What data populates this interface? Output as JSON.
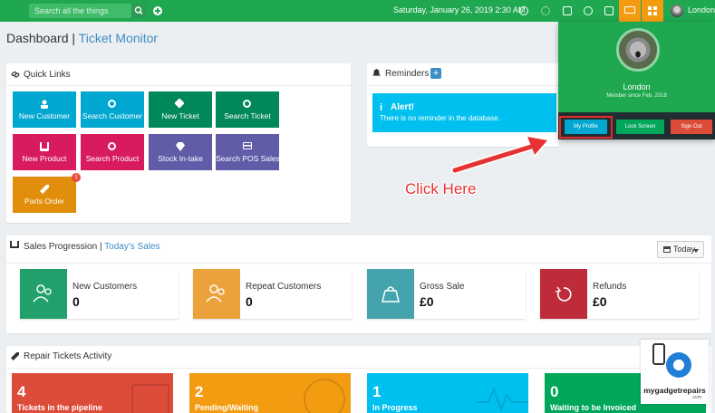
{
  "topbar": {
    "search_placeholder": "Search all the things",
    "datetime": "Saturday, January 26, 2019 2:30 AM",
    "user_name": "London"
  },
  "page": {
    "title": "Dashboard",
    "separator": "|",
    "subtitle": "Ticket Monitor"
  },
  "quick_links": {
    "title": "Quick Links",
    "items": [
      {
        "label": "New Customer",
        "color": "#00a7d0",
        "icon": "user-icon"
      },
      {
        "label": "Search Customer",
        "color": "#00a7d0",
        "icon": "search-icon"
      },
      {
        "label": "New Ticket",
        "color": "#00875a",
        "icon": "tag-icon"
      },
      {
        "label": "Search Ticket",
        "color": "#00875a",
        "icon": "search-icon"
      },
      {
        "label": "New Product",
        "color": "#d81b60",
        "icon": "cart-icon"
      },
      {
        "label": "Search Product",
        "color": "#d81b60",
        "icon": "search-icon"
      },
      {
        "label": "Stock In-take",
        "color": "#605ca8",
        "icon": "diamond-icon"
      },
      {
        "label": "Search POS Sales",
        "color": "#605ca8",
        "icon": "credit-card-icon"
      },
      {
        "label": "Parts Order",
        "color": "#e08e0b",
        "icon": "wrench-icon",
        "badge": "1"
      }
    ]
  },
  "reminders": {
    "title": "Reminders",
    "add_label": "+",
    "alert_icon": "i",
    "alert_title": "Alert!",
    "alert_message": "There is no reminder in the database."
  },
  "sales": {
    "title": "Sales Progression",
    "separator": "|",
    "subtitle": "Today's Sales",
    "range_label": "Today",
    "stats": [
      {
        "label": "New Customers",
        "value": "0",
        "color": "#22a06b",
        "icon": "users-icon"
      },
      {
        "label": "Repeat Customers",
        "value": "0",
        "color": "#eba23b",
        "icon": "users-icon"
      },
      {
        "label": "Gross Sale",
        "value": "£0",
        "color": "#44a3ad",
        "icon": "shopping-bag-icon"
      },
      {
        "label": "Refunds",
        "value": "£0",
        "color": "#be2c39",
        "icon": "refresh-icon"
      }
    ]
  },
  "repair": {
    "title": "Repair Tickets Activity",
    "tiles": [
      {
        "value": "4",
        "label": "Tickets in the pipeline",
        "color": "#dd4b39"
      },
      {
        "value": "2",
        "label": "Pending/Waiting",
        "color": "#f39c12"
      },
      {
        "value": "1",
        "label": "In Progress",
        "color": "#00c0ef"
      },
      {
        "value": "0",
        "label": "Waiting to be Invoiced",
        "color": "#00a65a"
      }
    ]
  },
  "user_menu": {
    "name": "London",
    "member_since": "Member since Feb. 2018",
    "profile_label": "My Profile",
    "lock_label": "Lock Screen",
    "signout_label": "Sign Out"
  },
  "annotation": {
    "text": "Click Here",
    "color": "#e63232"
  },
  "watermark": {
    "brand": "mygadgetrepairs",
    "suffix": ".com"
  },
  "colors": {
    "topbar": "#1fa84f",
    "accent_blue": "#3a8dc5"
  }
}
